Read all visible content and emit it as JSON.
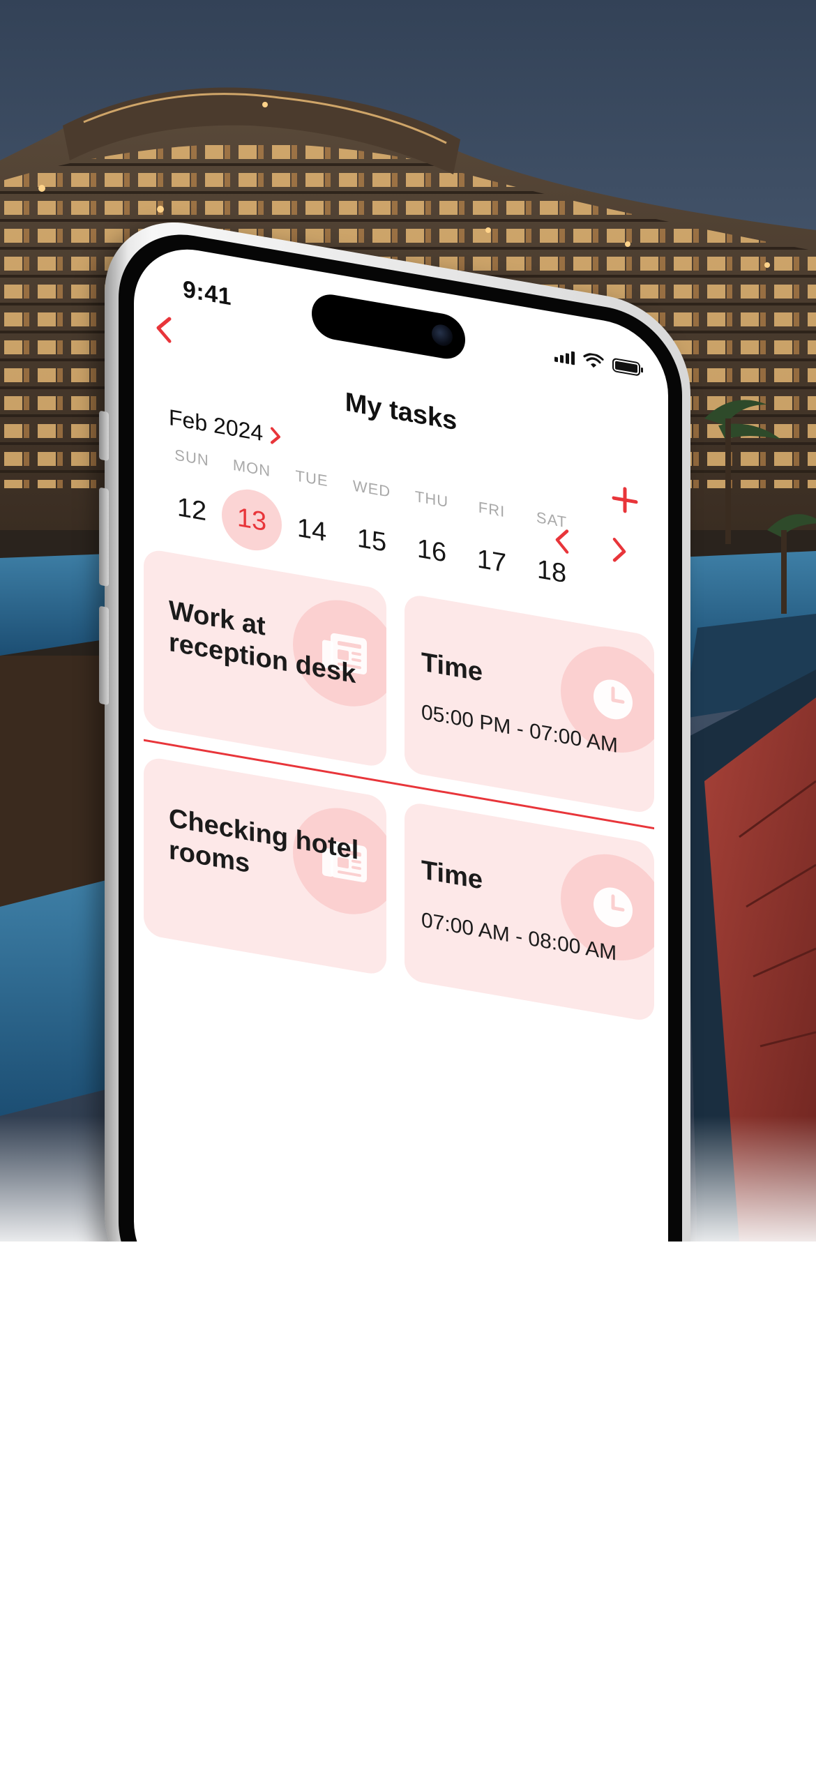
{
  "colors": {
    "accent": "#e8353a",
    "accent_soft": "#fbd4d4",
    "card_bg": "#fde8e8",
    "text": "#111111",
    "muted": "#a9a9a9"
  },
  "status_bar": {
    "time": "9:41",
    "icons": [
      "cellular-signal-icon",
      "wifi-icon",
      "battery-icon"
    ]
  },
  "nav": {
    "back_icon": "chevron-left-icon",
    "title": "My tasks"
  },
  "calendar": {
    "month_label": "Feb 2024",
    "month_icon": "chevron-right-icon",
    "add_icon": "plus-icon",
    "prev_week_icon": "chevron-left-icon",
    "next_week_icon": "chevron-right-icon",
    "days": [
      {
        "name": "SUN",
        "num": "12",
        "selected": false
      },
      {
        "name": "MON",
        "num": "13",
        "selected": true
      },
      {
        "name": "TUE",
        "num": "14",
        "selected": false
      },
      {
        "name": "WED",
        "num": "15",
        "selected": false
      },
      {
        "name": "THU",
        "num": "16",
        "selected": false
      },
      {
        "name": "FRI",
        "num": "17",
        "selected": false
      },
      {
        "name": "SAT",
        "num": "18",
        "selected": false
      }
    ]
  },
  "tasks": [
    {
      "title": "Work at reception desk",
      "task_icon": "newspaper-icon",
      "time_label": "Time",
      "time_range": "05:00 PM - 07:00 AM",
      "time_icon": "clock-icon"
    },
    {
      "title": "Checking hotel rooms",
      "task_icon": "newspaper-icon",
      "time_label": "Time",
      "time_range": "07:00 AM - 08:00 AM",
      "time_icon": "clock-icon"
    }
  ]
}
